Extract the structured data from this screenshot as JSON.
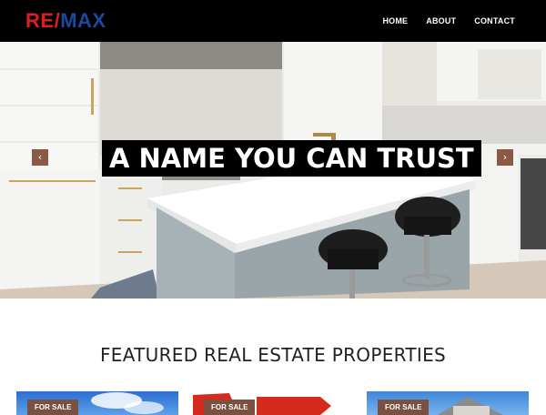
{
  "brand": {
    "logo_re": "RE",
    "logo_slash": "/",
    "logo_max": "MAX"
  },
  "nav": {
    "items": [
      "HOME",
      "ABOUT",
      "CONTACT"
    ]
  },
  "hero": {
    "headline": "A NAME YOU CAN TRUST",
    "prev_label": "‹",
    "next_label": "›"
  },
  "featured": {
    "title": "FEATURED REAL ESTATE PROPERTIES",
    "cards": [
      {
        "badge": "FOR SALE"
      },
      {
        "badge": "FOR SALE"
      },
      {
        "badge": "FOR SALE"
      }
    ]
  }
}
